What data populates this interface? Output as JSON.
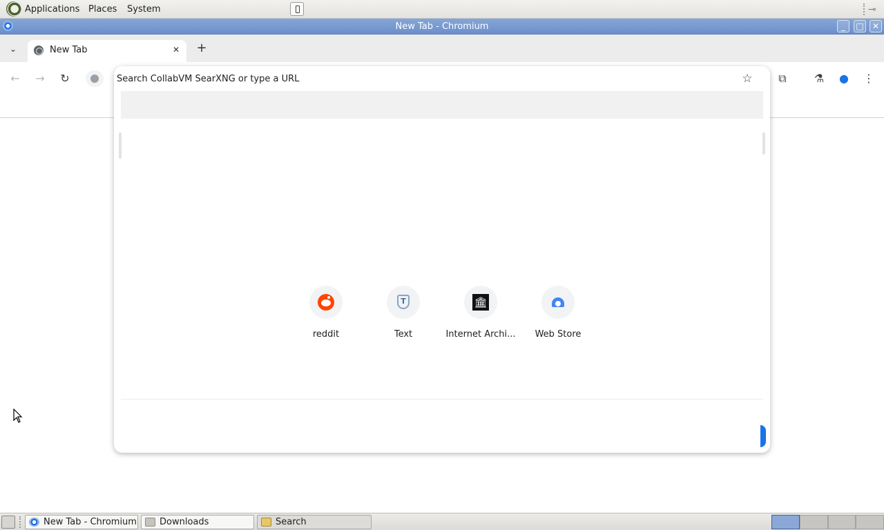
{
  "top_panel": {
    "menus": [
      "Applications",
      "Places",
      "System"
    ]
  },
  "window": {
    "title": "New Tab - Chromium",
    "buttons": {
      "minimize": "_",
      "maximize": "□",
      "close": "✕"
    }
  },
  "tabstrip": {
    "tab_search_glyph": "⌄",
    "active_tab_title": "New Tab",
    "tab_close_glyph": "✕",
    "new_tab_glyph": "+"
  },
  "toolbar": {
    "back_glyph": "←",
    "forward_glyph": "→",
    "reload_glyph": "↻",
    "omnibox_placeholder": "Search CollabVM SearXNG or type a URL",
    "bookmark_star_glyph": "☆",
    "extensions_glyph": "⧉",
    "labs_glyph": "⚗",
    "profile_glyph": "●",
    "menu_glyph": "⋮"
  },
  "shortcuts": [
    {
      "label": "reddit",
      "icon": "reddit-icon"
    },
    {
      "label": "Text",
      "icon": "text-icon"
    },
    {
      "label": "Internet Archi...",
      "icon": "internet-archive-icon"
    },
    {
      "label": "Web Store",
      "icon": "web-store-icon"
    }
  ],
  "taskbar": {
    "items": [
      {
        "label": "New Tab - Chromium",
        "icon": "chromium-icon"
      },
      {
        "label": "Downloads",
        "icon": "folder-icon"
      },
      {
        "label": "Search",
        "icon": "search-icon"
      }
    ],
    "workspaces": 4,
    "active_workspace": 1
  },
  "colors": {
    "title_bar": "#6b8fcb",
    "accent": "#1a73e8",
    "reddit": "#ff4500"
  }
}
